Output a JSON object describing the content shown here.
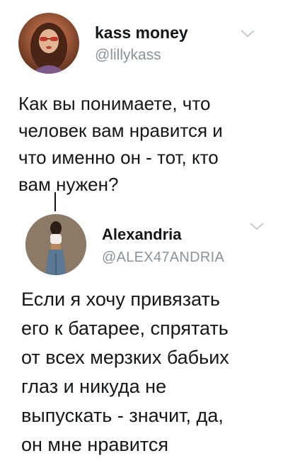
{
  "tweets": [
    {
      "display_name": "kass money",
      "handle": "@lillykass",
      "text_lines": [
        "Как вы понимаете, что",
        "человек вам нравится и",
        "что именно он - тот, кто",
        "вам нужен?"
      ],
      "menu_icon": "chevron-down-icon"
    },
    {
      "display_name": "Alexandria",
      "handle": "@ALEX47ANDRIA",
      "text_lines": [
        "Если я хочу привязать",
        "его к батарее, спрятать",
        "от всех мерзких бабьих",
        "глаз и никуда не",
        "выпускать - значит, да,",
        "он мне нравится"
      ],
      "menu_icon": "chevron-down-icon"
    }
  ],
  "colors": {
    "name": "#14171a",
    "handle": "#8a939b",
    "chevron": "#c6ccd2",
    "thread_line": "#111111"
  }
}
